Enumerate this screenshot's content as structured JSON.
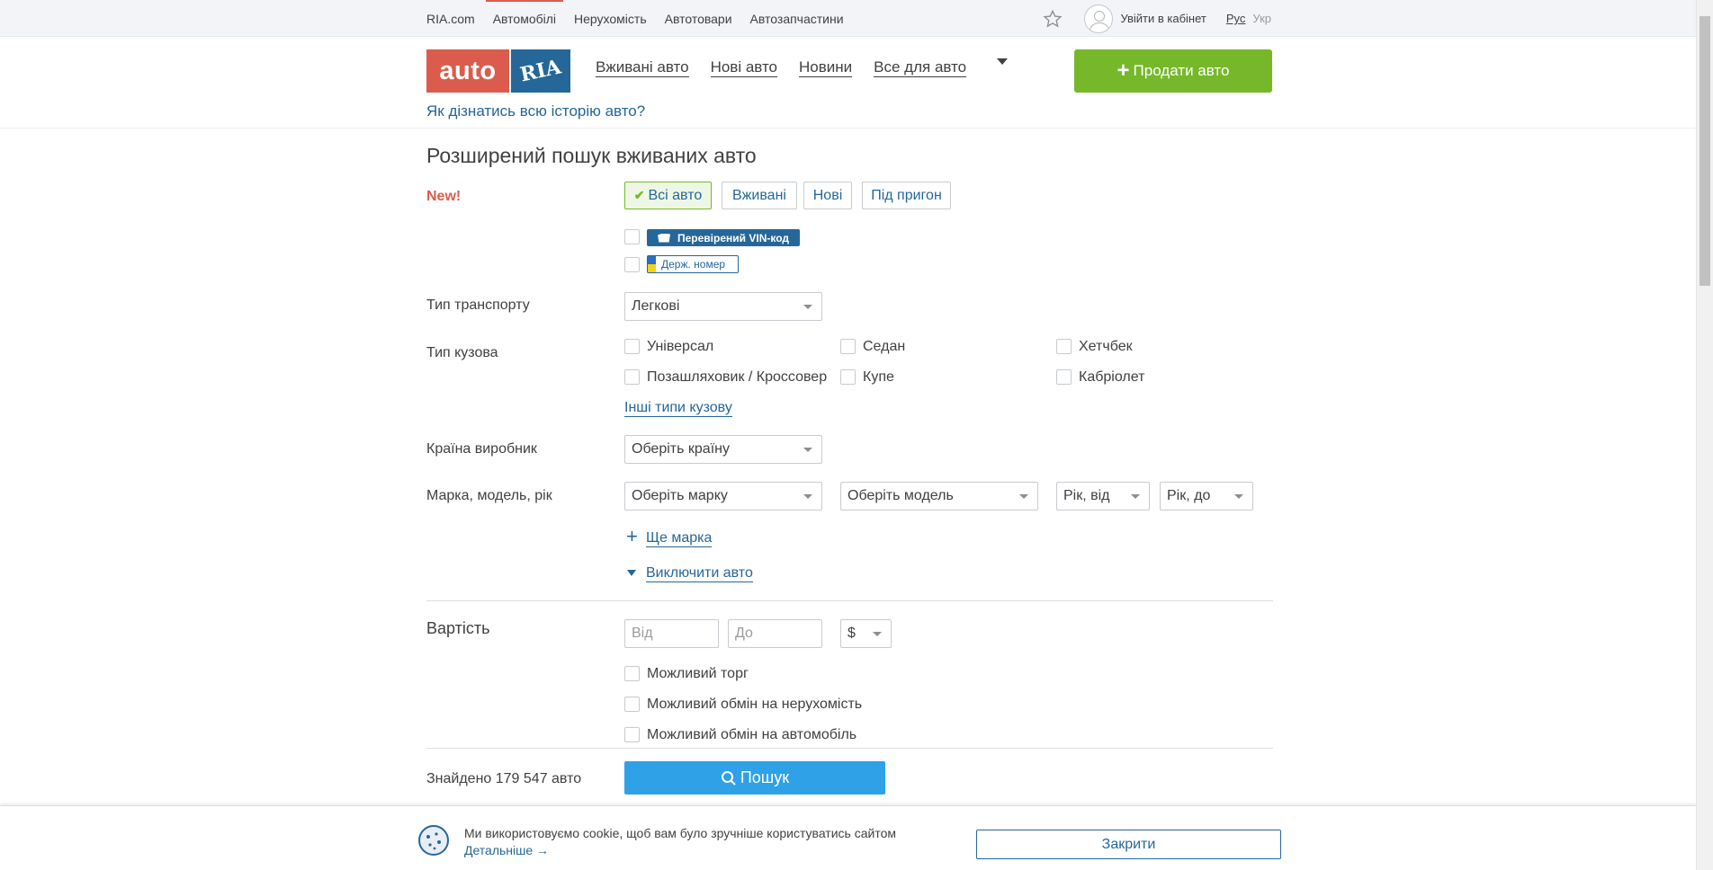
{
  "topbar": {
    "links": [
      "RIA.com",
      "Автомобілі",
      "Нерухомість",
      "Автотовари",
      "Автозапчастини"
    ],
    "login": "Увійти в кабінет",
    "lang_ru": "Рус",
    "lang_uk": "Укр"
  },
  "header": {
    "logo_auto": "auto",
    "logo_ria": "RIA",
    "nav": [
      "Вживані авто",
      "Нові авто",
      "Новини",
      "Все для авто"
    ],
    "sell_button": "Продати авто",
    "history_link": "Як дізнатись всю історію авто?"
  },
  "page": {
    "title": "Розширений пошук вживаних авто",
    "new_label": "New!",
    "segments": [
      "Всі авто",
      "Вживані",
      "Нові",
      "Під пригон"
    ],
    "vin_badge": "Перевірений VIN-код",
    "plate_badge": "Держ. номер",
    "transport_label": "Тип транспорту",
    "transport_value": "Легкові",
    "body_label": "Тип кузова",
    "body_types": [
      "Універсал",
      "Седан",
      "Хетчбек",
      "Позашляховик / Кроссовер",
      "Купе",
      "Кабріолет"
    ],
    "other_body_link": "Інші типи кузову",
    "country_label": "Країна виробник",
    "country_placeholder": "Оберіть країну",
    "brand_label": "Марка, модель, рік",
    "brand_placeholder": "Оберіть марку",
    "model_placeholder": "Оберіть модель",
    "year_from": "Рік, від",
    "year_to": "Рік, до",
    "add_brand": "Ще марка",
    "exclude_link": "Виключити авто",
    "price_label": "Вартість",
    "price_from": "Від",
    "price_to": "До",
    "currency": "$",
    "price_options": [
      "Можливий торг",
      "Можливий обмін на нерухомість",
      "Можливий обмін на автомобіль"
    ],
    "found_text": "Знайдено 179 547 авто",
    "search_button": "Пошук"
  },
  "cookie": {
    "text": "Ми використовуємо cookie, щоб вам було зручніше користуватись сайтом",
    "more": "Детальніше →",
    "close": "Закрити"
  },
  "colors": {
    "brand_red": "#db5c4c",
    "brand_blue": "#256799",
    "sell_green": "#76b82a",
    "search_blue": "#2fa1e6"
  }
}
